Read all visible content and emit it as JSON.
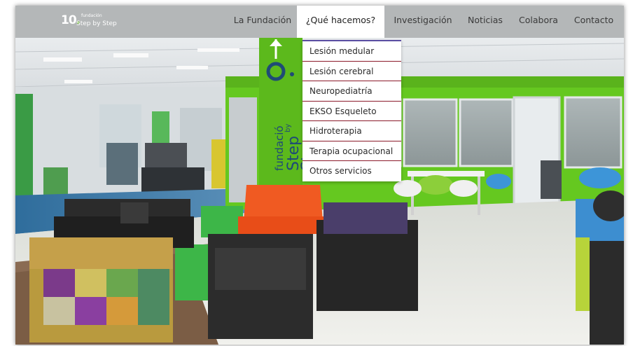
{
  "header": {
    "logo": {
      "number": "10",
      "dot": ".",
      "small_text": "fundación",
      "name": "Step by Step"
    },
    "nav": [
      {
        "label": "La Fundación"
      },
      {
        "label": "¿Qué hacemos?"
      },
      {
        "label": "Investigación"
      },
      {
        "label": "Noticias"
      },
      {
        "label": "Colabora"
      },
      {
        "label": "Contacto"
      }
    ]
  },
  "dropdown": {
    "items": [
      {
        "label": "Lesión medular"
      },
      {
        "label": "Lesión cerebral"
      },
      {
        "label": "Neuropediatría"
      },
      {
        "label": "EKSO Esqueleto"
      },
      {
        "label": "Hidroterapia"
      },
      {
        "label": "Terapia ocupacional"
      },
      {
        "label": "Otros servicios"
      }
    ]
  },
  "pillar_sign": {
    "line1": "fundació",
    "line2": "Step",
    "line3": "by",
    "line4": "Step"
  },
  "colors": {
    "header_bg": "#b4b7b8",
    "brand_green": "#65c820",
    "dropdown_accent": "#5b4ea2",
    "divider_red": "#8b1a2a",
    "sign_blue": "#1f4b76"
  }
}
